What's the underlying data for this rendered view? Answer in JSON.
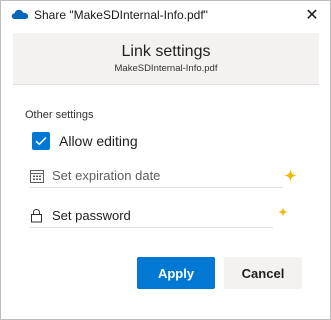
{
  "window": {
    "title": "Share \"MakeSDInternal-Info.pdf\"",
    "close_glyph": "✕",
    "icon": "onedrive-cloud-icon"
  },
  "header": {
    "title": "Link settings",
    "subtitle": "MakeSDInternal-Info.pdf"
  },
  "settings": {
    "section_label": "Other settings",
    "allow_editing": {
      "label": "Allow editing",
      "checked": true
    },
    "expiration": {
      "placeholder": "Set expiration date",
      "icon": "calendar-icon"
    },
    "password": {
      "placeholder": "Set password",
      "icon": "lock-icon"
    }
  },
  "buttons": {
    "apply": "Apply",
    "cancel": "Cancel"
  },
  "colors": {
    "accent": "#0078d4",
    "sparkle": "#f2b700",
    "header_bg": "#f3f2f1"
  }
}
